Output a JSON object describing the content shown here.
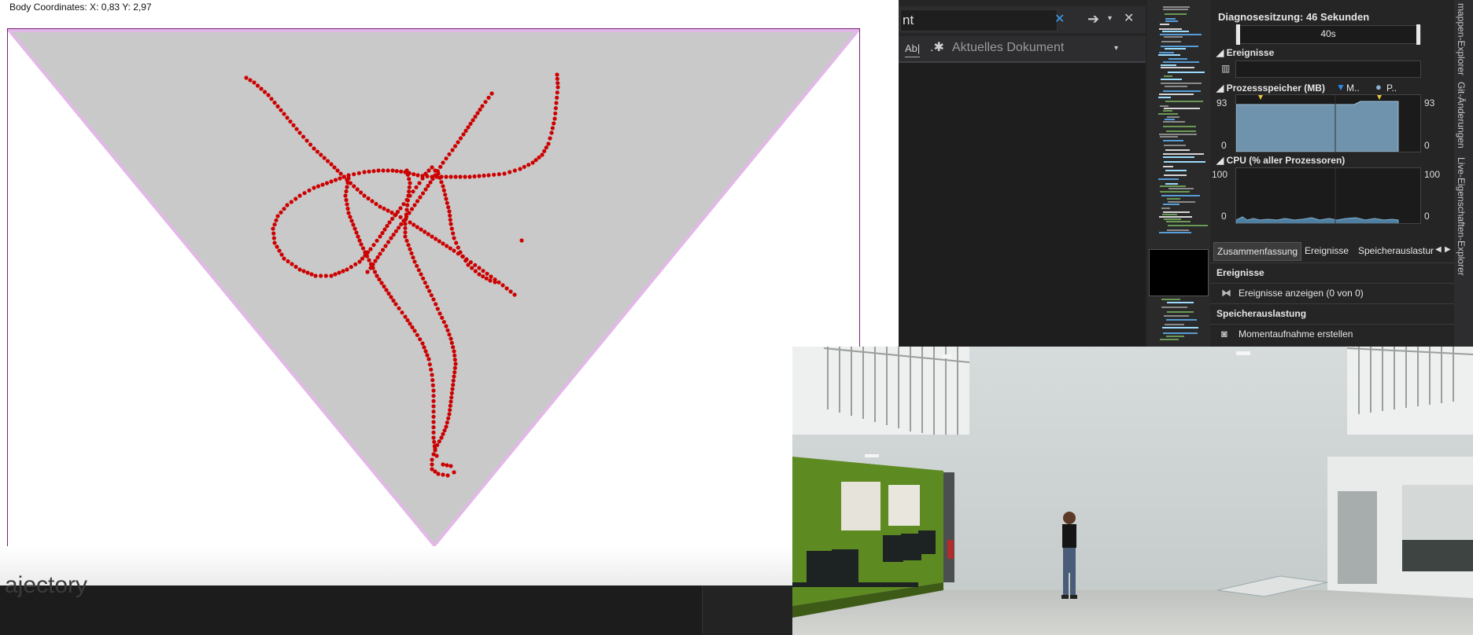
{
  "tracker": {
    "coords_text": "Body Coordinates: X: 0,83 Y: 2,97",
    "bottom_ghost_text": "ajectory",
    "colors": {
      "triangle_fill": "#c9c9c9",
      "triangle_edge": "#e2b8e6",
      "frame": "#7a1f7a",
      "trajectory": "#cc0000"
    }
  },
  "vs": {
    "find_text": "nt",
    "scope_label": "Aktuelles Dokument",
    "diag": {
      "session_title": "Diagnosesitzung: 46 Sekunden",
      "timeline_label": "40s",
      "events_header": "Ereignisse",
      "memory_header": "Prozessspeicher (MB)",
      "memory_legend_m": "M..",
      "memory_legend_p": "P..",
      "memory_max_left": "93",
      "memory_max_right": "93",
      "memory_min_left": "0",
      "memory_min_right": "0",
      "cpu_header": "CPU (% aller Prozessoren)",
      "cpu_max_left": "100",
      "cpu_max_right": "100",
      "cpu_min_left": "0",
      "cpu_min_right": "0",
      "tabs": [
        "Zusammenfassung",
        "Ereignisse",
        "Speicherauslastur"
      ],
      "section_events": "Ereignisse",
      "events_item": "Ereignisse anzeigen (0 von 0)",
      "section_memory": "Speicherauslastung",
      "memory_item": "Momentaufnahme erstellen"
    },
    "side_tabs": [
      "mappen-Explorer",
      "Git-Änderungen",
      "Live-Eigenschaften-Explorer"
    ]
  }
}
